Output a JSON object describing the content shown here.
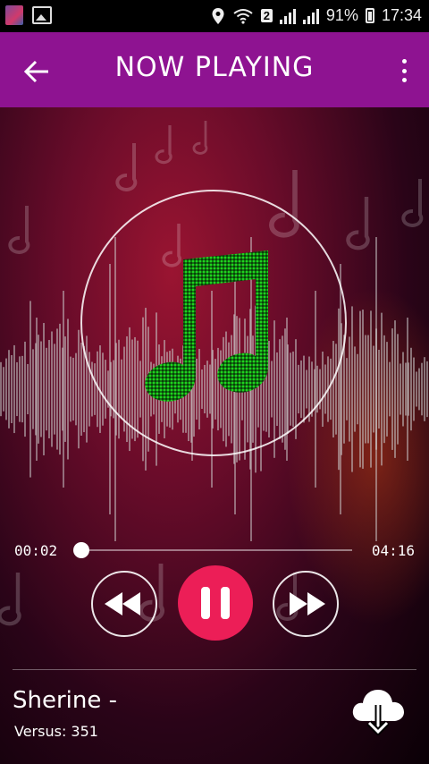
{
  "status_bar": {
    "sim_badge": "2",
    "battery": "91%",
    "time": "17:34"
  },
  "top_bar": {
    "title": "NOW PLAYING"
  },
  "player": {
    "current_time": "00:02",
    "total_time": "04:16",
    "progress_fraction": 0.008,
    "is_playing": true
  },
  "track": {
    "title": "Sherine -",
    "versus_label": "Versus: 351"
  },
  "colors": {
    "header": "#8e1391",
    "play_button": "#ec1e57",
    "note": "#1ed41e"
  },
  "icons": {
    "back": "arrow-left",
    "menu": "more-vert",
    "rewind": "rewind",
    "pause": "pause",
    "fast_forward": "fast-forward",
    "download": "cloud-download"
  }
}
